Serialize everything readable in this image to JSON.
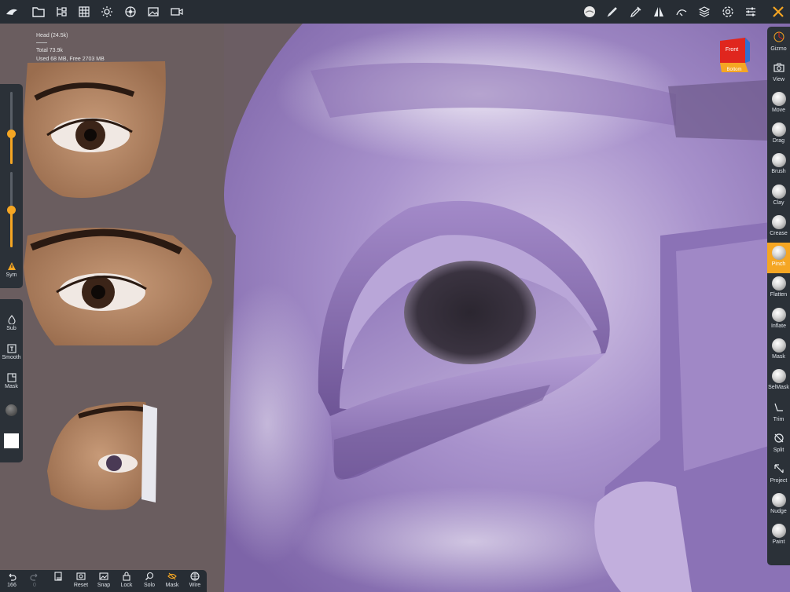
{
  "stats": {
    "mesh": "Head (24.5k)",
    "total": "Total 73.9k",
    "memory": "Used 68 MB,  Free 2703 MB"
  },
  "top_icons": [
    "logo-icon",
    "folder-icon",
    "scene-icon",
    "grid-icon",
    "sun-icon",
    "material-icon",
    "image-icon",
    "camera-icon",
    "brush-preview-icon",
    "stroke-icon",
    "dropper-icon",
    "symmetry-icon",
    "curve-icon",
    "layers-icon",
    "settings-icon",
    "sliders-icon",
    "tools-icon"
  ],
  "left_panel": {
    "sym_label": "Sym",
    "sub_label": "Sub",
    "smooth_label": "Smooth",
    "mask_label": "Mask",
    "radius_level": 0.6,
    "intensity_level": 0.5
  },
  "right_tools": [
    {
      "label": "Gizmo",
      "icon": "gizmo-icon"
    },
    {
      "label": "View",
      "icon": "camera-icon"
    },
    {
      "label": "Move",
      "icon": "sphere-icon"
    },
    {
      "label": "Drag",
      "icon": "sphere-icon"
    },
    {
      "label": "Brush",
      "icon": "sphere-icon"
    },
    {
      "label": "Clay",
      "icon": "sphere-icon"
    },
    {
      "label": "Crease",
      "icon": "sphere-icon"
    },
    {
      "label": "Pinch",
      "icon": "sphere-icon",
      "active": true
    },
    {
      "label": "Flatten",
      "icon": "sphere-icon"
    },
    {
      "label": "Inflate",
      "icon": "sphere-icon"
    },
    {
      "label": "Mask",
      "icon": "sphere-icon"
    },
    {
      "label": "SelMask",
      "icon": "sphere-icon"
    },
    {
      "label": "Trim",
      "icon": "trim-icon"
    },
    {
      "label": "Split",
      "icon": "split-icon"
    },
    {
      "label": "Project",
      "icon": "project-icon"
    },
    {
      "label": "Nudge",
      "icon": "sphere-icon"
    },
    {
      "label": "Paint",
      "icon": "sphere-icon"
    }
  ],
  "bottom_bar": {
    "undo_count": "166",
    "redo_count": "0",
    "reset_label": "Reset",
    "snap_label": "Snap",
    "lock_label": "Lock",
    "solo_label": "Solo",
    "mask_label": "Mask",
    "wire_label": "Wire"
  },
  "view_cube": {
    "front_label": "Front",
    "bottom_label": "Bottom"
  },
  "colors": {
    "accent": "#f5a623",
    "toolbar_bg": "#2b3138",
    "mesh": "#9a82c0"
  }
}
